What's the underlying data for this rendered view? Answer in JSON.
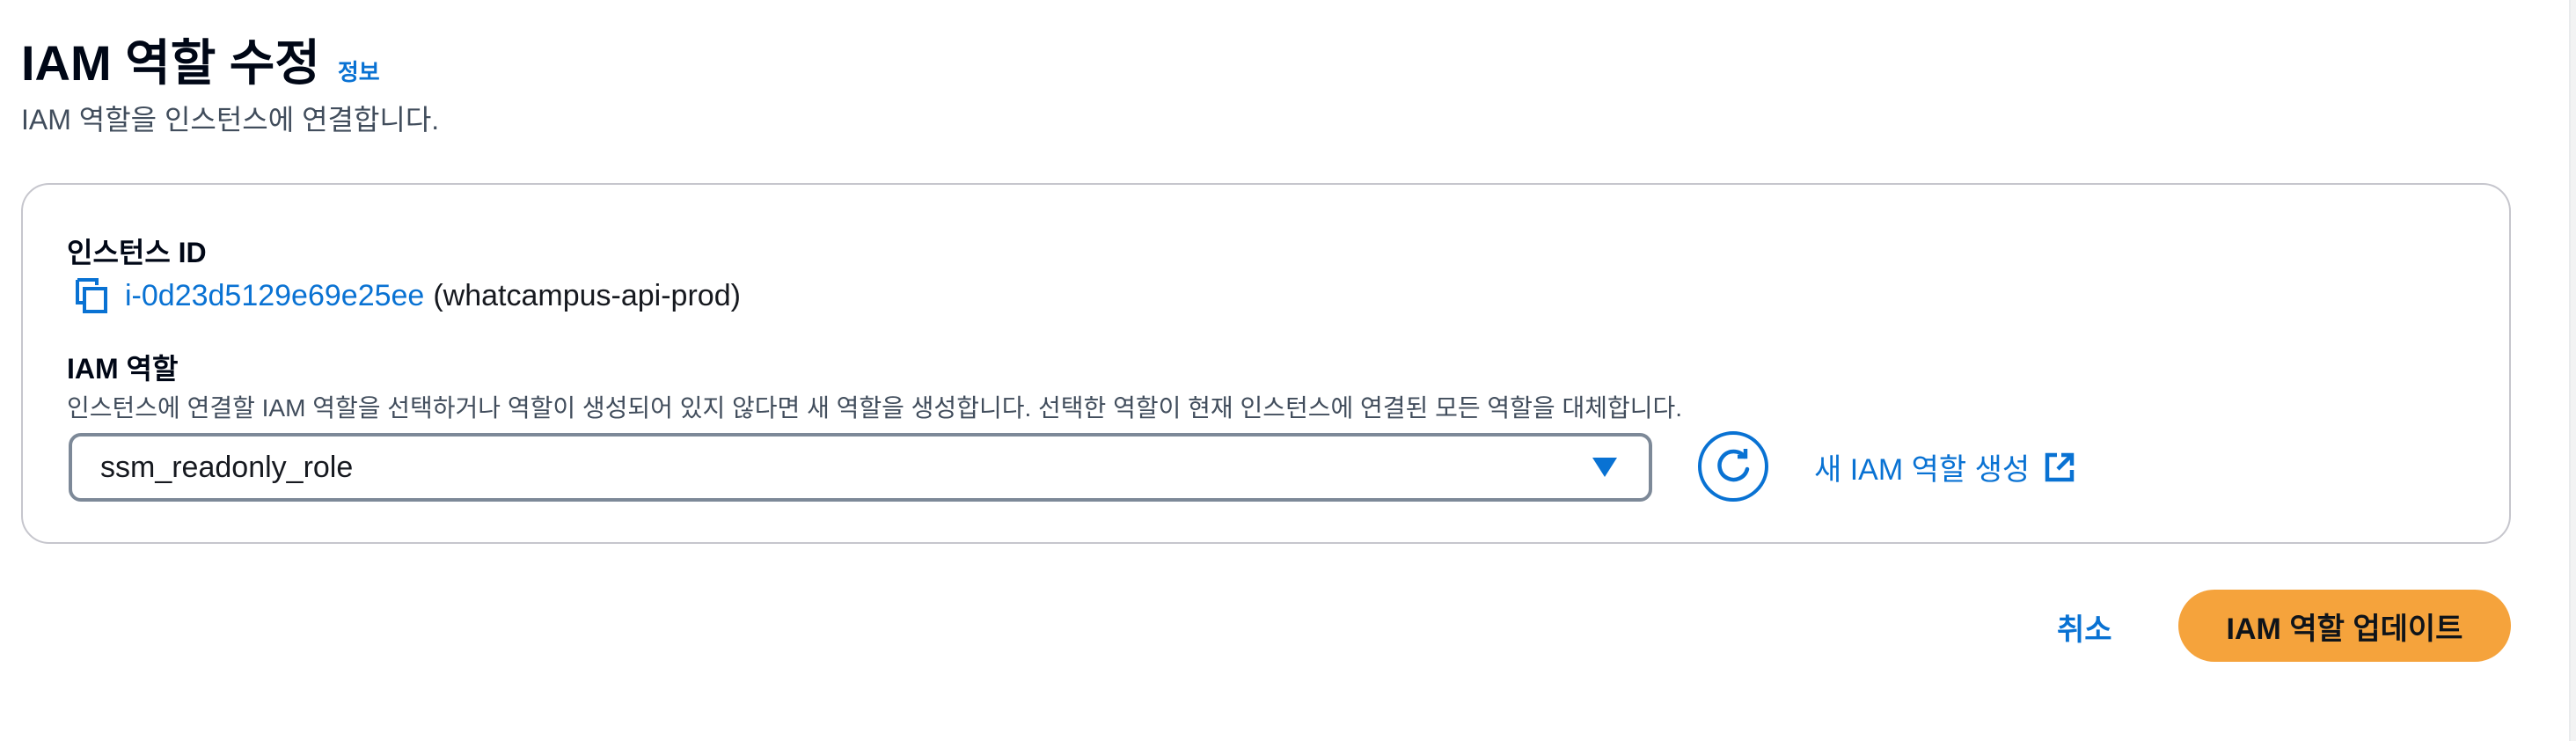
{
  "header": {
    "title": "IAM 역할 수정",
    "info_link": "정보",
    "description": "IAM 역할을 인스턴스에 연결합니다."
  },
  "instance": {
    "label": "인스턴스 ID",
    "id": "i-0d23d5129e69e25ee",
    "name": "(whatcampus-api-prod)",
    "copy_icon": "copy-icon"
  },
  "role": {
    "label": "IAM 역할",
    "description": "인스턴스에 연결할 IAM 역할을 선택하거나 역할이 생성되어 있지 않다면 새 역할을 생성합니다. 선택한 역할이 현재 인스턴스에 연결된 모든 역할을 대체합니다.",
    "selected": "ssm_readonly_role",
    "refresh_icon": "refresh-icon",
    "create_link": "새 IAM 역할 생성",
    "external_icon": "external-link-icon"
  },
  "actions": {
    "cancel": "취소",
    "update": "IAM 역할 업데이트"
  },
  "colors": {
    "link": "#0972d3",
    "primary_button": "#f5a33c",
    "text": "#000716",
    "muted_text": "#414d5c",
    "border": "#c6c6cd"
  }
}
